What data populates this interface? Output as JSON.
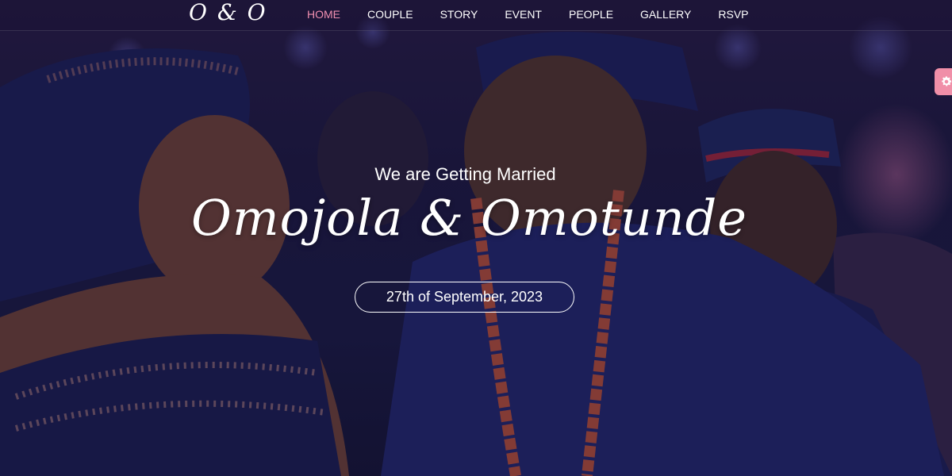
{
  "logo": "O & O",
  "nav": {
    "items": [
      {
        "label": "HOME",
        "active": true
      },
      {
        "label": "COUPLE",
        "active": false
      },
      {
        "label": "STORY",
        "active": false
      },
      {
        "label": "EVENT",
        "active": false
      },
      {
        "label": "PEOPLE",
        "active": false
      },
      {
        "label": "GALLERY",
        "active": false
      },
      {
        "label": "RSVP",
        "active": false
      }
    ]
  },
  "hero": {
    "tagline": "We are Getting Married",
    "names": "Omojola & Omotunde",
    "date": "27th of September, 2023"
  },
  "settings": {
    "icon": "gear-icon"
  },
  "colors": {
    "accent": "#f08fb0",
    "settings_tab": "#f08fa8"
  }
}
